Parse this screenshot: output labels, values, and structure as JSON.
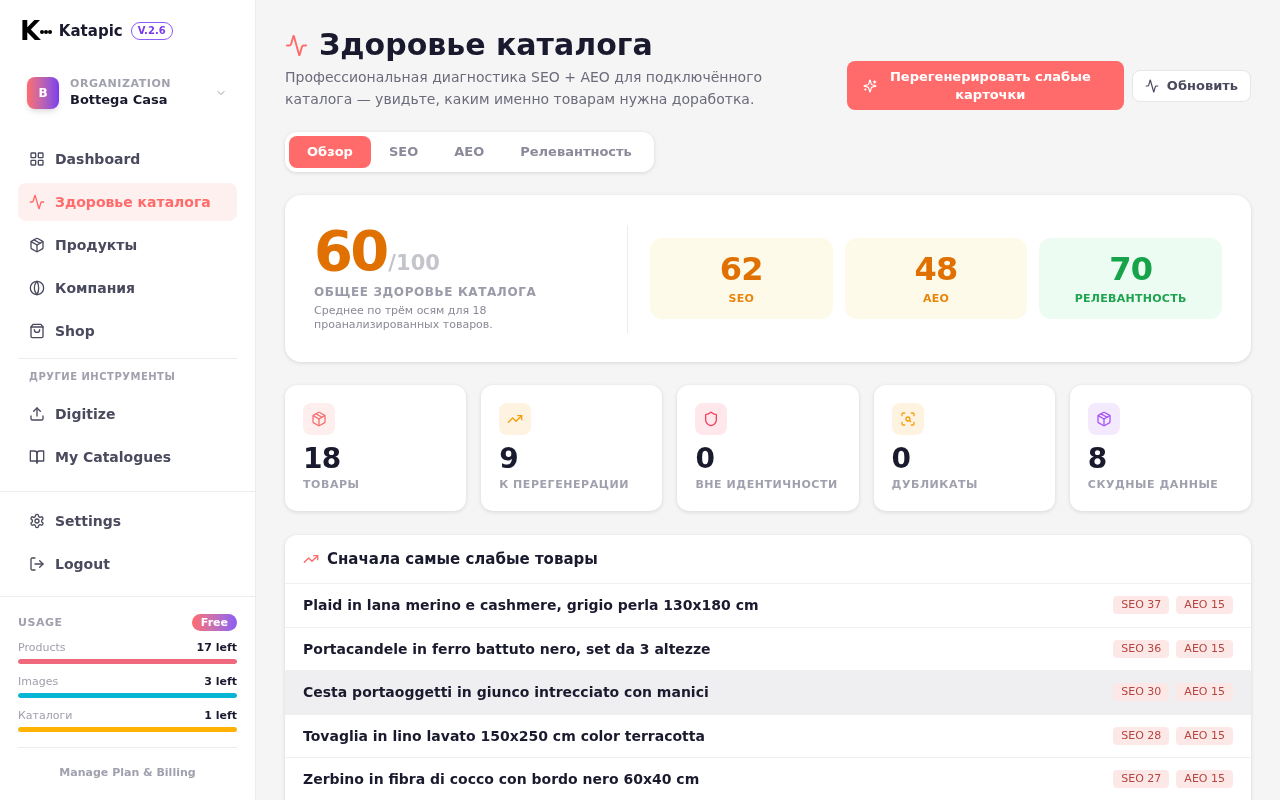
{
  "sidebar": {
    "logo": {
      "mark": "K",
      "name": "Katapic",
      "version": "V.2.6"
    },
    "organization": {
      "label": "ORGANIZATION",
      "name": "Bottega Casa",
      "initial": "B"
    },
    "nav_items": [
      {
        "label": "Dashboard",
        "selected": false
      },
      {
        "label": "Здоровье каталога",
        "selected": true
      },
      {
        "label": "Продукты",
        "selected": false
      },
      {
        "label": "Компания",
        "selected": false
      },
      {
        "label": "Shop",
        "selected": false
      }
    ],
    "tools_heading": "ДРУГИЕ ИНСТРУМЕНТЫ",
    "tool_items": [
      {
        "label": "Digitize",
        "selected": false
      },
      {
        "label": "My Catalogues",
        "selected": false
      }
    ],
    "account_items": [
      {
        "label": "Settings",
        "selected": false
      },
      {
        "label": "Logout",
        "selected": false
      }
    ],
    "usage": {
      "title": "USAGE",
      "plan": "Free",
      "meters": [
        {
          "label": "Products",
          "reading": "17 left",
          "level": 1,
          "color": "#f0687c"
        },
        {
          "label": "Images",
          "reading": "3 left",
          "level": 1,
          "color": "#06b6d4"
        },
        {
          "label": "Каталоги",
          "reading": "1 left",
          "level": 1,
          "color": "#ffb300"
        }
      ]
    },
    "billing_link": "Manage Plan & Billing"
  },
  "header": {
    "title": "Здоровье каталога",
    "subtitle": "Профессиональная диагностика SEO + AEO для подключённого каталога — увидьте, каким именно товарам нужна доработка.",
    "buttons": [
      {
        "label": "Перегенерировать слабые карточки",
        "kind": "primary"
      },
      {
        "label": "Обновить",
        "kind": "secondary"
      }
    ]
  },
  "tabs": [
    {
      "label": "Обзор",
      "selected": true
    },
    {
      "label": "SEO",
      "selected": false
    },
    {
      "label": "AEO",
      "selected": false
    },
    {
      "label": "Релевантность",
      "selected": false
    }
  ],
  "health": {
    "score": "60",
    "max": "/100",
    "label": "ОБЩЕЕ ЗДОРОВЬЕ КАТАЛОГА",
    "description": "Среднее по трём осям для 18 проанализированных товаров.",
    "axes": [
      {
        "score": "62",
        "label": "SEO",
        "kind": "fair"
      },
      {
        "score": "48",
        "label": "AEO",
        "kind": "fair"
      },
      {
        "score": "70",
        "label": "РЕЛЕВАНТНОСТЬ",
        "kind": "good"
      }
    ]
  },
  "stats": [
    {
      "value": "18",
      "label": "ТОВАРЫ",
      "color": "#f87171"
    },
    {
      "value": "9",
      "label": "К ПЕРЕГЕНЕРАЦИИ",
      "color": "#f59e0b"
    },
    {
      "value": "0",
      "label": "ВНЕ ИДЕНТИЧНОСТИ",
      "color": "#f43f5e"
    },
    {
      "value": "0",
      "label": "ДУБЛИКАТЫ",
      "color": "#f59e0b"
    },
    {
      "value": "8",
      "label": "СКУДНЫЕ ДАННЫЕ",
      "color": "#a855f7"
    }
  ],
  "weakest": {
    "title": "Сначала самые слабые товары",
    "rows": [
      {
        "name": "Plaid in lana merino e cashmere, grigio perla 130x180 cm",
        "badges": [
          "SEO 37",
          "AEO 15"
        ],
        "hovered": false
      },
      {
        "name": "Portacandele in ferro battuto nero, set da 3 altezze",
        "badges": [
          "SEO 36",
          "AEO 15"
        ],
        "hovered": false
      },
      {
        "name": "Cesta portaoggetti in giunco intrecciato con manici",
        "badges": [
          "SEO 30",
          "AEO 15"
        ],
        "hovered": true
      },
      {
        "name": "Tovaglia in lino lavato 150x250 cm color terracotta",
        "badges": [
          "SEO 28",
          "AEO 15"
        ],
        "hovered": false
      },
      {
        "name": "Zerbino in fibra di cocco con bordo nero 60x40 cm",
        "badges": [
          "SEO 27",
          "AEO 15"
        ],
        "hovered": false
      }
    ]
  }
}
